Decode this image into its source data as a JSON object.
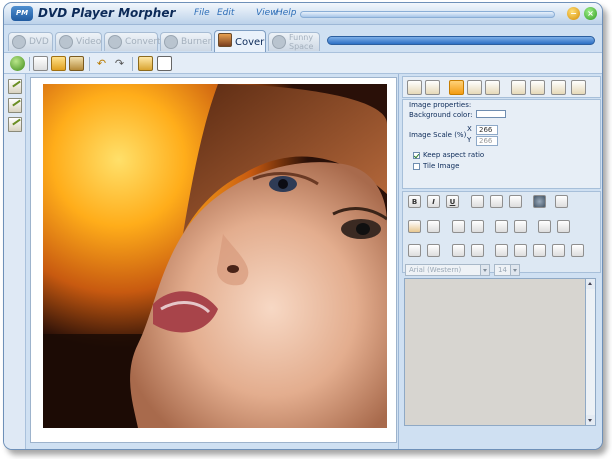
{
  "app": {
    "title": "DVD Player Morpher",
    "logo_text": "PM"
  },
  "menu": {
    "file": "File",
    "edit": "Edit",
    "view": "View",
    "help": "Help"
  },
  "tabs": [
    {
      "label": "DVD",
      "active": false
    },
    {
      "label": "Video",
      "active": false
    },
    {
      "label": "Convert",
      "active": false
    },
    {
      "label": "Burner",
      "active": false
    },
    {
      "label": "Cover",
      "active": true
    },
    {
      "label": "Funny Space",
      "active": false
    }
  ],
  "toolbar": {
    "icons": [
      "refresh-icon",
      "new-icon",
      "open-icon",
      "save-icon",
      "undo-icon",
      "redo-icon",
      "print-icon",
      "frame-icon"
    ]
  },
  "left_tools": {
    "icons": [
      "edit-front-icon",
      "edit-back-icon",
      "edit-inside-icon"
    ]
  },
  "properties": {
    "heading": "Image properties:",
    "background_label": "Background color:",
    "background_color": "#ffffff",
    "scale_label": "Image Scale (%)",
    "x_label": "X",
    "y_label": "Y",
    "scale_x": "266",
    "scale_y": "266",
    "keep_aspect_label": "Keep aspect ratio",
    "keep_aspect_checked": true,
    "tile_label": "Tile Image",
    "tile_checked": false
  },
  "format": {
    "bold": "B",
    "italic": "I",
    "underline": "U"
  },
  "font": {
    "family": "Arial (Western)",
    "size": "14"
  },
  "colors": {
    "accent": "#2c6fc5",
    "title_text": "#0c2a58",
    "panel_bg": "#cfe0f2"
  }
}
